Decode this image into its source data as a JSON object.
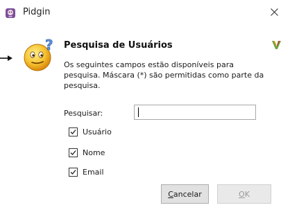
{
  "window": {
    "title": "Pidgin",
    "app_icon": "pidgin-icon",
    "close_icon": "close-icon"
  },
  "dialog": {
    "icon": "smiley-question-icon",
    "heading": "Pesquisa de Usuários",
    "logo_icon": "service-logo-icon",
    "description": "Os seguintes campos estão disponíveis para pesquisa. Máscara (*) são permitidas como parte da pesquisa."
  },
  "search": {
    "label": "Pesquisar:",
    "value": ""
  },
  "options": [
    {
      "label": "Usuário",
      "checked": true
    },
    {
      "label": "Nome",
      "checked": true
    },
    {
      "label": "Email",
      "checked": true
    }
  ],
  "buttons": {
    "cancel": {
      "mnemonic": "C",
      "rest": "ancelar",
      "enabled": true
    },
    "ok": {
      "mnemonic": "O",
      "rest": "K",
      "enabled": false
    }
  }
}
